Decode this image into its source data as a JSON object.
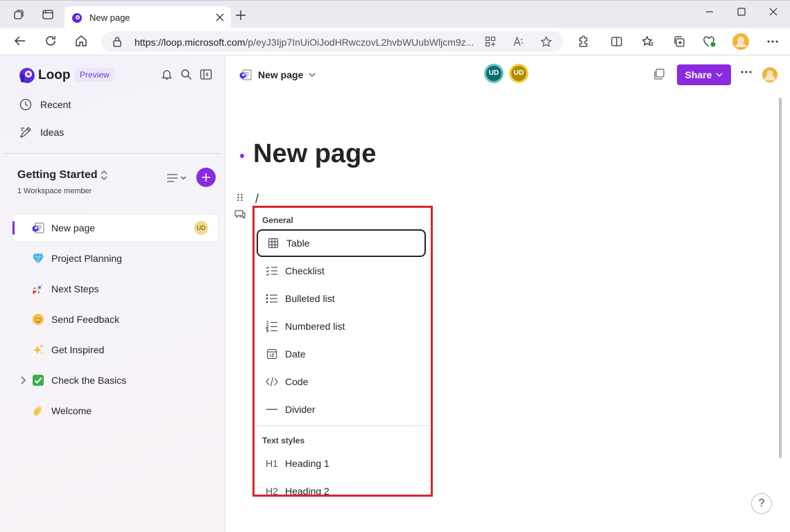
{
  "browser": {
    "tab_title": "New page",
    "url_host": "https://loop.microsoft.com",
    "url_path": "/p/eyJ3Ijp7InUiOiJodHRwczovL2hvbWUubWljcm9z..."
  },
  "sidebar": {
    "app_name": "Loop",
    "badge": "Preview",
    "nav": [
      {
        "label": "Recent"
      },
      {
        "label": "Ideas"
      }
    ],
    "workspace": {
      "title": "Getting Started",
      "members": "1 Workspace member"
    },
    "pages": [
      {
        "label": "New page",
        "icon": "page-icon",
        "badge": "UD"
      },
      {
        "label": "Project Planning",
        "icon": "gem-icon"
      },
      {
        "label": "Next Steps",
        "icon": "rocket-icon"
      },
      {
        "label": "Send Feedback",
        "icon": "smiley-icon"
      },
      {
        "label": "Get Inspired",
        "icon": "sparkles-icon"
      },
      {
        "label": "Check the Basics",
        "icon": "checkmark-icon"
      },
      {
        "label": "Welcome",
        "icon": "wave-icon"
      }
    ]
  },
  "header": {
    "breadcrumb": "New page",
    "avatars": [
      "UD",
      "UD"
    ],
    "share_label": "Share"
  },
  "page": {
    "title": "New page",
    "typed": "/"
  },
  "menu": {
    "section_general": "General",
    "items": [
      {
        "label": "Table",
        "icon": "table-icon"
      },
      {
        "label": "Checklist",
        "icon": "checklist-icon"
      },
      {
        "label": "Bulleted list",
        "icon": "bulleted-list-icon"
      },
      {
        "label": "Numbered list",
        "icon": "numbered-list-icon"
      },
      {
        "label": "Date",
        "icon": "calendar-icon"
      },
      {
        "label": "Code",
        "icon": "code-icon"
      },
      {
        "label": "Divider",
        "icon": "divider-icon"
      }
    ],
    "section_text": "Text styles",
    "text_items": [
      {
        "label": "Heading 1",
        "icon_text": "H1"
      },
      {
        "label": "Heading 2",
        "icon_text": "H2"
      }
    ]
  },
  "help_label": "?",
  "colors": {
    "accent": "#8a2be2",
    "highlight_border": "#d9262b"
  }
}
